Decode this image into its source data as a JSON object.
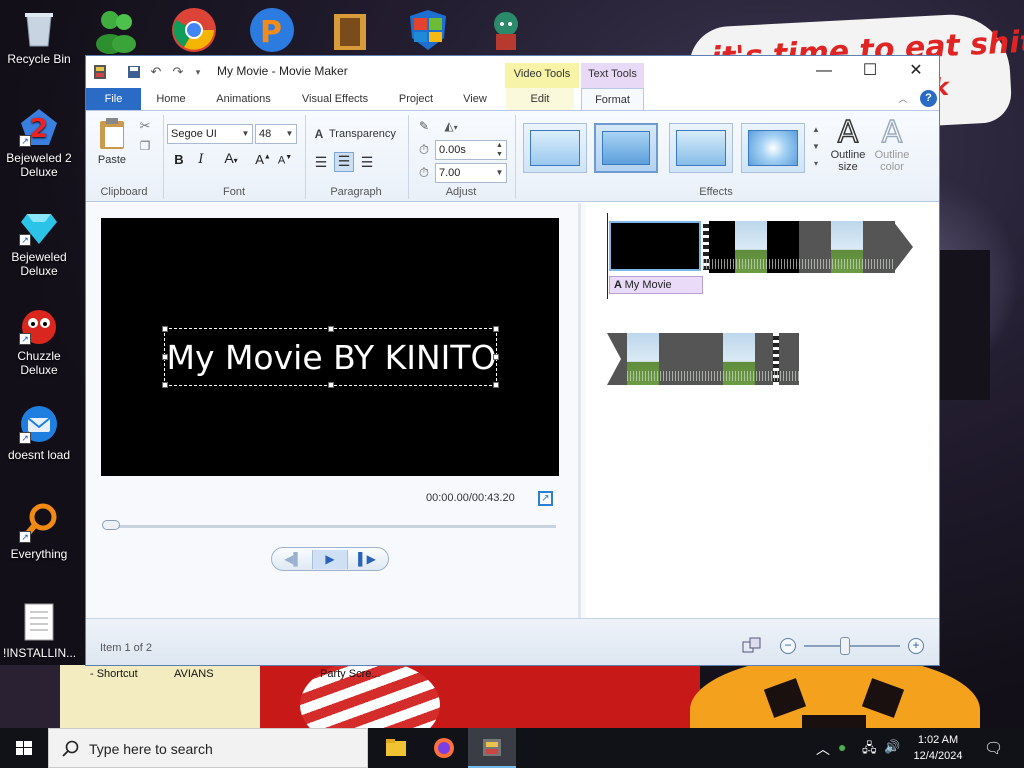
{
  "desktop": {
    "wallpaper_text": [
      "it's time to eat shit",
      "ck"
    ],
    "icons": [
      {
        "label": "Recycle Bin"
      },
      {
        "label": "Bejeweled 2 Deluxe"
      },
      {
        "label": "Bejeweled Deluxe"
      },
      {
        "label": "Chuzzle Deluxe"
      },
      {
        "label": "doesnt load"
      },
      {
        "label": "Everything"
      },
      {
        "label": "!INSTALLIN..."
      }
    ],
    "bottom_labels": [
      "- Shortcut",
      "AVIANS",
      "Party Scre..."
    ]
  },
  "window": {
    "title": "My Movie - Movie Maker",
    "context_headers": {
      "video_tools": "Video Tools",
      "text_tools": "Text Tools"
    },
    "tabs": {
      "file": "File",
      "home": "Home",
      "animations": "Animations",
      "visual_effects": "Visual Effects",
      "project": "Project",
      "view": "View",
      "edit": "Edit",
      "format": "Format"
    },
    "ribbon": {
      "clipboard": {
        "paste": "Paste",
        "group": "Clipboard"
      },
      "font": {
        "family": "Segoe UI",
        "size": "48",
        "group": "Font"
      },
      "paragraph": {
        "transparency": "Transparency",
        "group": "Paragraph"
      },
      "adjust": {
        "start_time": "0.00s",
        "duration": "7.00",
        "group": "Adjust"
      },
      "effects": {
        "outline_size": "Outline size",
        "outline_color": "Outline color",
        "group": "Effects"
      }
    },
    "preview": {
      "caption": "My Movie BY KINITO",
      "timecode": "00:00.00/00:43.20",
      "progress": 0.0
    },
    "storyboard": {
      "caption_chip": "My Movie"
    },
    "status": {
      "item_text": "Item 1 of 2"
    }
  },
  "taskbar": {
    "search_placeholder": "Type here to search",
    "time": "1:02 AM",
    "date": "12/4/2024"
  }
}
